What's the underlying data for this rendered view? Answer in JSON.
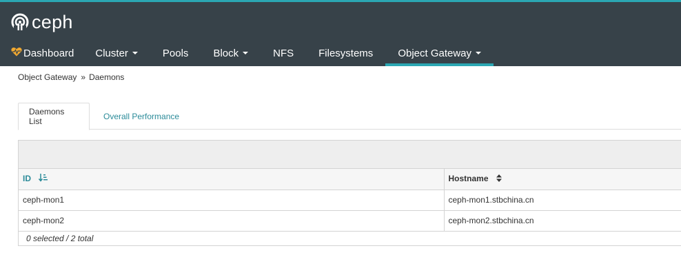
{
  "brand": {
    "name": "ceph",
    "logo_icon": "ceph-logo-icon"
  },
  "colors": {
    "navbar": "#374249",
    "accent": "#2ba7b3",
    "link": "#2b8b99",
    "heart": "#f0a830"
  },
  "nav": {
    "items": [
      {
        "label": "Dashboard",
        "icon": "heart-icon"
      },
      {
        "label": "Cluster",
        "dropdown": true
      },
      {
        "label": "Pools"
      },
      {
        "label": "Block",
        "dropdown": true
      },
      {
        "label": "NFS"
      },
      {
        "label": "Filesystems"
      },
      {
        "label": "Object Gateway",
        "dropdown": true,
        "active": true
      }
    ]
  },
  "breadcrumb": {
    "parent": "Object Gateway",
    "separator": "»",
    "current": "Daemons"
  },
  "tabs": [
    {
      "label": "Daemons List",
      "active": true
    },
    {
      "label": "Overall Performance",
      "active": false
    }
  ],
  "table": {
    "columns": [
      {
        "label": "ID",
        "sort": "ascending"
      },
      {
        "label": "Hostname",
        "sort": "sortable"
      }
    ],
    "rows": [
      [
        "ceph-mon1",
        "ceph-mon1.stbchina.cn"
      ],
      [
        "ceph-mon2",
        "ceph-mon2.stbchina.cn"
      ]
    ],
    "footer": "0 selected / 2 total"
  }
}
